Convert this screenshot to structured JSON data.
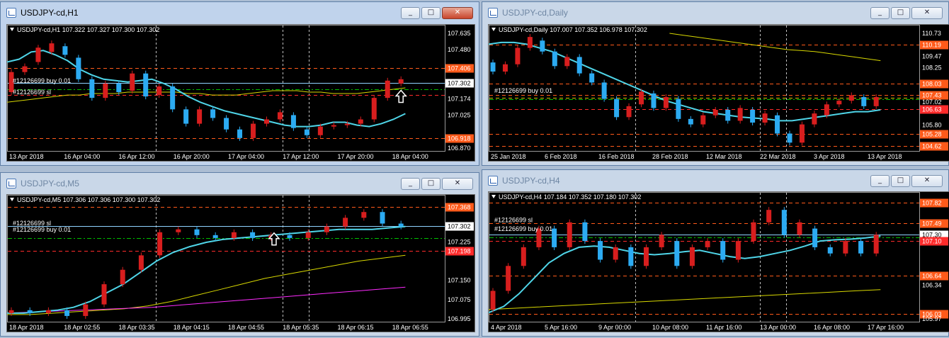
{
  "windows": [
    {
      "id": "h1",
      "title": "USDJPY-cd,H1",
      "active": true,
      "header": "USDJPY-cd,H1  107.322 107.327 107.300 107.302",
      "price_labels": [
        "107.635",
        "107.480",
        "107.406",
        "107.302",
        "107.174",
        "107.025",
        "106.918",
        "106.870"
      ],
      "time_labels": [
        "13 Apr 2018",
        "16 Apr 04:00",
        "16 Apr 12:00",
        "16 Apr 20:00",
        "17 Apr 04:00",
        "17 Apr 12:00",
        "17 Apr 20:00",
        "18 Apr 04:00"
      ],
      "order_labels": [
        "#12126699 buy 0.01",
        "#12126699 sl"
      ],
      "ylim": [
        106.85,
        107.65
      ],
      "last_price": 107.302,
      "levels": [
        {
          "price": 107.406,
          "color": "#ff5a1a",
          "style": "dash",
          "label": "107.406"
        },
        {
          "price": 107.26,
          "color": "#00c000",
          "style": "dashdot",
          "label": ""
        },
        {
          "price": 107.22,
          "color": "#ff2b2b",
          "style": "dash",
          "label": ""
        },
        {
          "price": 107.302,
          "color": "#8fd2ff",
          "style": "solid",
          "label": "107.302"
        },
        {
          "price": 106.918,
          "color": "#ff5a1a",
          "style": "dash",
          "label": "106.918"
        }
      ],
      "series_ma": [
        107.45,
        107.47,
        107.52,
        107.53,
        107.5,
        107.46,
        107.4,
        107.36,
        107.33,
        107.32,
        107.31,
        107.32,
        107.33,
        107.3,
        107.26,
        107.21,
        107.17,
        107.14,
        107.11,
        107.09,
        107.07,
        107.05,
        107.03,
        107.01,
        107,
        107,
        107.01,
        107.03,
        107.03,
        107.01,
        107,
        107.02,
        107.05,
        107.09
      ],
      "series_slow": [
        107.17,
        107.18,
        107.19,
        107.2,
        107.21,
        107.22,
        107.22,
        107.23,
        107.23,
        107.23,
        107.24,
        107.24,
        107.24,
        107.24,
        107.24,
        107.23,
        107.23,
        107.22,
        107.22,
        107.22,
        107.23,
        107.24,
        107.25,
        107.25,
        107.25,
        107.24,
        107.24,
        107.23,
        107.23,
        107.23,
        107.24,
        107.25,
        107.26,
        107.27
      ],
      "candles": [
        [
          107.24,
          107.38
        ],
        [
          107.38,
          107.42
        ],
        [
          107.45,
          107.55
        ],
        [
          107.52,
          107.58
        ],
        [
          107.56,
          107.5
        ],
        [
          107.48,
          107.33
        ],
        [
          107.33,
          107.2
        ],
        [
          107.2,
          107.3
        ],
        [
          107.3,
          107.24
        ],
        [
          107.25,
          107.37
        ],
        [
          107.37,
          107.21
        ],
        [
          107.22,
          107.28
        ],
        [
          107.28,
          107.12
        ],
        [
          107.12,
          107.02
        ],
        [
          107.02,
          107.12
        ],
        [
          107.12,
          107.06
        ],
        [
          107.06,
          106.98
        ],
        [
          106.98,
          106.92
        ],
        [
          106.92,
          107.02
        ],
        [
          107.02,
          107.05
        ],
        [
          107.05,
          107.1
        ],
        [
          107.08,
          106.99
        ],
        [
          106.98,
          106.94
        ],
        [
          106.94,
          107.0
        ],
        [
          107.0,
          107.01
        ],
        [
          107.01,
          107.02
        ],
        [
          107.02,
          107.05
        ],
        [
          107.05,
          107.2
        ],
        [
          107.2,
          107.32
        ],
        [
          107.3,
          107.33
        ]
      ],
      "arrow_at": 0.9
    },
    {
      "id": "d1",
      "title": "USDJPY-cd,Daily",
      "active": false,
      "header": "USDJPY-cd,Daily  107.007 107.352 106.978 107.302",
      "price_labels": [
        "110.73",
        "110.19",
        "109.47",
        "108.25",
        "108.03",
        "107.43",
        "107.02",
        "106.63",
        "105.80",
        "105.28",
        "104.62"
      ],
      "time_labels": [
        "25 Jan 2018",
        "6 Feb 2018",
        "16 Feb 2018",
        "28 Feb 2018",
        "12 Mar 2018",
        "22 Mar 2018",
        "3 Apr 2018",
        "13 Apr 2018"
      ],
      "order_labels": [
        "#12126699 buy 0.01"
      ],
      "ylim": [
        104.5,
        110.8
      ],
      "last_price": 107.302,
      "levels": [
        {
          "price": 110.19,
          "color": "#ff5a1a",
          "style": "dash",
          "label": "110.19"
        },
        {
          "price": 108.03,
          "color": "#ff5a1a",
          "style": "dash",
          "label": "108.03"
        },
        {
          "price": 107.43,
          "color": "#ff5a1a",
          "style": "dash",
          "label": "107.43"
        },
        {
          "price": 107.25,
          "color": "#c8c800",
          "style": "dash",
          "label": ""
        },
        {
          "price": 107.18,
          "color": "#00c000",
          "style": "dashdot",
          "label": ""
        },
        {
          "price": 106.63,
          "color": "#ff2b2b",
          "style": "dash",
          "label": "106.63"
        },
        {
          "price": 105.28,
          "color": "#ff5a1a",
          "style": "dash",
          "label": "105.28"
        },
        {
          "price": 104.62,
          "color": "#ff5a1a",
          "style": "dash",
          "label": "104.62"
        }
      ],
      "series_ma": [
        110.2,
        110.3,
        110.3,
        110.2,
        110,
        109.8,
        109.5,
        109.2,
        108.9,
        108.6,
        108.3,
        108,
        107.7,
        107.4,
        107.1,
        106.9,
        106.7,
        106.5,
        106.4,
        106.3,
        106.2,
        106.15,
        106.1,
        106.0,
        106.0,
        106.1,
        106.2,
        106.3,
        106.4,
        106.5,
        106.5,
        106.6
      ],
      "series_slow": [
        110.8,
        110.7,
        110.6,
        110.5,
        110.4,
        110.3,
        110.2,
        110.1,
        110.0,
        109.9,
        109.85,
        109.8,
        109.7,
        109.6,
        109.5,
        109.4,
        109.3
      ],
      "candles": [
        [
          109.2,
          108.7
        ],
        [
          108.7,
          109.1
        ],
        [
          109.1,
          110.0
        ],
        [
          110.0,
          110.6
        ],
        [
          110.4,
          109.8
        ],
        [
          109.8,
          109.0
        ],
        [
          109.0,
          109.5
        ],
        [
          109.5,
          108.6
        ],
        [
          108.6,
          108.1
        ],
        [
          108.1,
          107.2
        ],
        [
          107.2,
          106.2
        ],
        [
          106.2,
          106.8
        ],
        [
          106.9,
          107.6
        ],
        [
          107.5,
          106.7
        ],
        [
          106.7,
          107.3
        ],
        [
          107.2,
          106.1
        ],
        [
          106.1,
          105.8
        ],
        [
          105.8,
          106.3
        ],
        [
          106.3,
          106.6
        ],
        [
          106.6,
          106.0
        ],
        [
          106.0,
          106.7
        ],
        [
          106.6,
          105.9
        ],
        [
          105.9,
          106.4
        ],
        [
          106.3,
          105.3
        ],
        [
          105.3,
          104.8
        ],
        [
          104.8,
          105.8
        ],
        [
          105.8,
          106.4
        ],
        [
          106.3,
          106.9
        ],
        [
          106.9,
          107.1
        ],
        [
          107.1,
          107.4
        ],
        [
          107.3,
          106.8
        ],
        [
          106.8,
          107.3
        ]
      ],
      "arrow_at": -1
    },
    {
      "id": "m5",
      "title": "USDJPY-cd,M5",
      "active": false,
      "header": "USDJPY-cd,M5  107.306 107.306 107.300 107.302",
      "price_labels": [
        "107.368",
        "107.302",
        "107.225",
        "107.198",
        "107.150",
        "107.075",
        "106.995"
      ],
      "time_labels": [
        "18 Apr 2018",
        "18 Apr 02:55",
        "18 Apr 03:35",
        "18 Apr 04:15",
        "18 Apr 04:55",
        "18 Apr 05:35",
        "18 Apr 06:15",
        "18 Apr 06:55"
      ],
      "order_labels": [
        "#12126699 buy 0.01",
        "#12126699 sl"
      ],
      "ylim": [
        106.98,
        107.38
      ],
      "last_price": 107.302,
      "levels": [
        {
          "price": 107.368,
          "color": "#ff5a1a",
          "style": "dash",
          "label": "107.368"
        },
        {
          "price": 107.302,
          "color": "#8fd2ff",
          "style": "solid",
          "label": "107.302"
        },
        {
          "price": 107.26,
          "color": "#00c000",
          "style": "dashdot",
          "label": ""
        },
        {
          "price": 107.216,
          "color": "#ff2b2b",
          "style": "dash",
          "label": "107.198"
        }
      ],
      "series_ma": [
        107.0,
        107.0,
        107.005,
        107.01,
        107.02,
        107.04,
        107.07,
        107.1,
        107.14,
        107.18,
        107.21,
        107.23,
        107.245,
        107.255,
        107.26,
        107.265,
        107.27,
        107.275,
        107.28,
        107.285,
        107.29,
        107.29,
        107.29,
        107.295,
        107.3
      ],
      "series_slow": [
        106.995,
        106.995,
        107.0,
        107.005,
        107.01,
        107.015,
        107.025,
        107.04,
        107.06,
        107.08,
        107.1,
        107.12,
        107.135,
        107.15,
        107.165,
        107.18,
        107.19,
        107.2
      ],
      "series_slow2": [
        107.0,
        107.005,
        107.01,
        107.015,
        107.02,
        107.03,
        107.04,
        107.05,
        107.06,
        107.07,
        107.08,
        107.09
      ],
      "candles": [
        [
          107.0,
          107.01
        ],
        [
          107.01,
          107.0
        ],
        [
          107.0,
          107.01
        ],
        [
          107.01,
          106.99
        ],
        [
          106.99,
          107.03
        ],
        [
          107.03,
          107.1
        ],
        [
          107.1,
          107.15
        ],
        [
          107.15,
          107.2
        ],
        [
          107.2,
          107.28
        ],
        [
          107.28,
          107.29
        ],
        [
          107.29,
          107.27
        ],
        [
          107.27,
          107.26
        ],
        [
          107.26,
          107.28
        ],
        [
          107.28,
          107.26
        ],
        [
          107.26,
          107.27
        ],
        [
          107.27,
          107.26
        ],
        [
          107.26,
          107.28
        ],
        [
          107.28,
          107.3
        ],
        [
          107.3,
          107.33
        ],
        [
          107.33,
          107.35
        ],
        [
          107.35,
          107.31
        ],
        [
          107.31,
          107.3
        ]
      ],
      "arrow_at": 0.61
    },
    {
      "id": "h4",
      "title": "USDJPY-cd,H4",
      "active": false,
      "header": "USDJPY-cd,H4  107.184 107.352 107.180 107.302",
      "price_labels": [
        "107.82",
        "107.49",
        "107.30",
        "107.10",
        "106.64",
        "106.34",
        "106.03",
        "105.97"
      ],
      "time_labels": [
        "4 Apr 2018",
        "5 Apr 16:00",
        "9 Apr 00:00",
        "10 Apr 08:00",
        "11 Apr 16:00",
        "13 Apr 00:00",
        "16 Apr 08:00",
        "17 Apr 16:00"
      ],
      "order_labels": [
        "#12126699 buy 0.01",
        "#12126699 sl"
      ],
      "ylim": [
        105.95,
        107.85
      ],
      "last_price": 107.302,
      "levels": [
        {
          "price": 107.82,
          "color": "#ff5a1a",
          "style": "dash",
          "label": "107.82"
        },
        {
          "price": 107.49,
          "color": "#ff5a1a",
          "style": "dash",
          "label": "107.49"
        },
        {
          "price": 107.302,
          "color": "#8fd2ff",
          "style": "solid",
          "label": "107.30"
        },
        {
          "price": 107.26,
          "color": "#00c000",
          "style": "dashdot",
          "label": ""
        },
        {
          "price": 107.2,
          "color": "#ff2b2b",
          "style": "dash",
          "label": "107.10"
        },
        {
          "price": 106.64,
          "color": "#ff5a1a",
          "style": "dash",
          "label": "106.64"
        },
        {
          "price": 106.03,
          "color": "#ff5a1a",
          "style": "dash",
          "label": "106.03"
        }
      ],
      "series_ma": [
        106.05,
        106.15,
        106.35,
        106.6,
        106.85,
        107.0,
        107.1,
        107.12,
        107.1,
        107.05,
        107.0,
        106.98,
        107.0,
        107.03,
        107.05,
        107.0,
        106.95,
        106.92,
        106.95,
        107.0,
        107.05,
        107.12,
        107.2,
        107.22,
        107.23,
        107.25,
        107.28
      ],
      "series_slow": [
        106.1,
        106.12,
        106.14,
        106.16,
        106.18,
        106.2,
        106.22,
        106.24,
        106.26,
        106.28,
        106.3,
        106.32,
        106.34,
        106.36,
        106.38,
        106.4,
        106.42
      ],
      "candles": [
        [
          106.1,
          106.4
        ],
        [
          106.4,
          106.8
        ],
        [
          106.8,
          107.1
        ],
        [
          107.1,
          107.4
        ],
        [
          107.4,
          107.1
        ],
        [
          107.1,
          107.5
        ],
        [
          107.5,
          107.2
        ],
        [
          107.2,
          106.9
        ],
        [
          106.9,
          107.1
        ],
        [
          107.1,
          106.8
        ],
        [
          106.8,
          107.1
        ],
        [
          107.1,
          107.3
        ],
        [
          107.2,
          106.8
        ],
        [
          106.8,
          107.1
        ],
        [
          107.1,
          107.2
        ],
        [
          107.2,
          106.9
        ],
        [
          106.9,
          107.2
        ],
        [
          107.2,
          107.5
        ],
        [
          107.5,
          107.7
        ],
        [
          107.7,
          107.3
        ],
        [
          107.3,
          107.5
        ],
        [
          107.4,
          107.1
        ],
        [
          107.1,
          107.0
        ],
        [
          107.0,
          107.2
        ],
        [
          107.2,
          107.0
        ],
        [
          107.0,
          107.3
        ]
      ],
      "arrow_at": -1
    }
  ],
  "window_buttons": [
    "_",
    "□",
    "✕"
  ]
}
